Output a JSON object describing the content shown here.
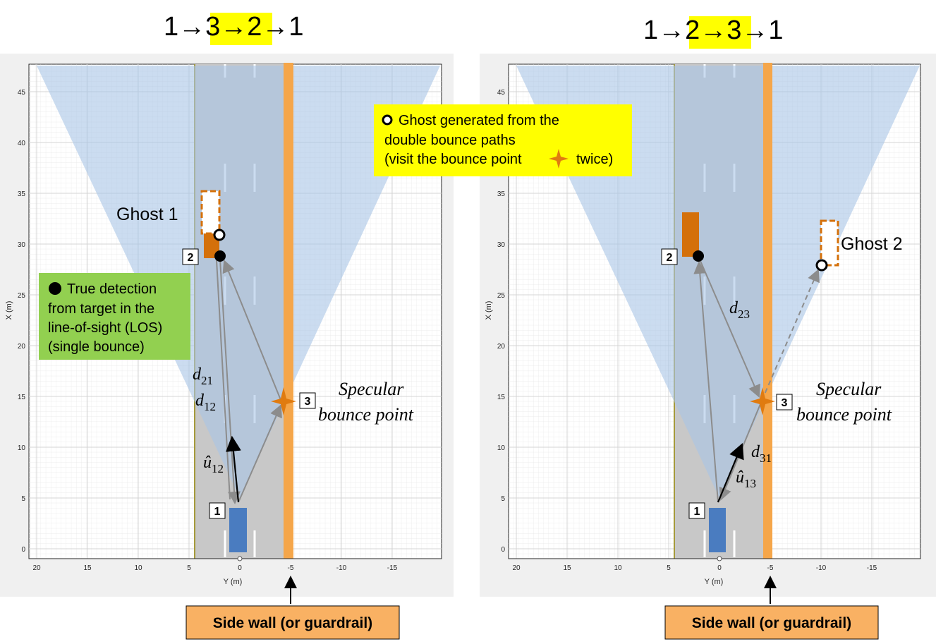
{
  "panels": [
    {
      "id": "left",
      "title": "1→3→2→1",
      "title_parts": [
        "1",
        "→",
        "3",
        "→",
        "2",
        "→",
        "1"
      ],
      "highlighted": "3→2",
      "ghost_label": "Ghost 1",
      "bounce_label_line1": "Specular",
      "bounce_label_line2": "bounce point",
      "d_a": "d",
      "d_a_sub": "21",
      "d_b": "d",
      "d_b_sub": "12",
      "u_label": "û",
      "u_sub": "12",
      "side_wall_label": "Side wall (or guardrail)",
      "markers": [
        "1",
        "2",
        "3"
      ]
    },
    {
      "id": "right",
      "title": "1→2→3→1",
      "title_parts": [
        "1",
        "→",
        "2",
        "→",
        "3",
        "→",
        "1"
      ],
      "highlighted": "2→3",
      "ghost_label": "Ghost 2",
      "bounce_label_line1": "Specular",
      "bounce_label_line2": "bounce point",
      "d_a": "d",
      "d_a_sub": "23",
      "d_b": "d",
      "d_b_sub": "31",
      "u_label": "û",
      "u_sub": "13",
      "side_wall_label": "Side wall (or guardrail)",
      "markers": [
        "1",
        "2",
        "3"
      ]
    }
  ],
  "axes": {
    "xlabel": "Y (m)",
    "ylabel": "X (m)",
    "x_ticks": [
      "20",
      "15",
      "10",
      "5",
      "0",
      "-5",
      "-10",
      "-15"
    ],
    "y_ticks": [
      "0",
      "5",
      "10",
      "15",
      "20",
      "25",
      "30",
      "35",
      "40",
      "45"
    ]
  },
  "callouts": {
    "true_detection": [
      "True detection",
      "from target in the",
      "line-of-sight (LOS)",
      "(single bounce)"
    ],
    "ghost_note": [
      "Ghost generated from the",
      "double bounce paths",
      "(visit the bounce point",
      "twice)"
    ]
  },
  "colors": {
    "fov": "#c5d6ea",
    "road": "#c8c8c8",
    "wall": "#f5a64a",
    "ego": "#4a7cc0",
    "target": "#d4700a",
    "true_callout": "#92d050",
    "ghost_callout": "#ffff00",
    "wall_label_bg": "#f9b163"
  }
}
